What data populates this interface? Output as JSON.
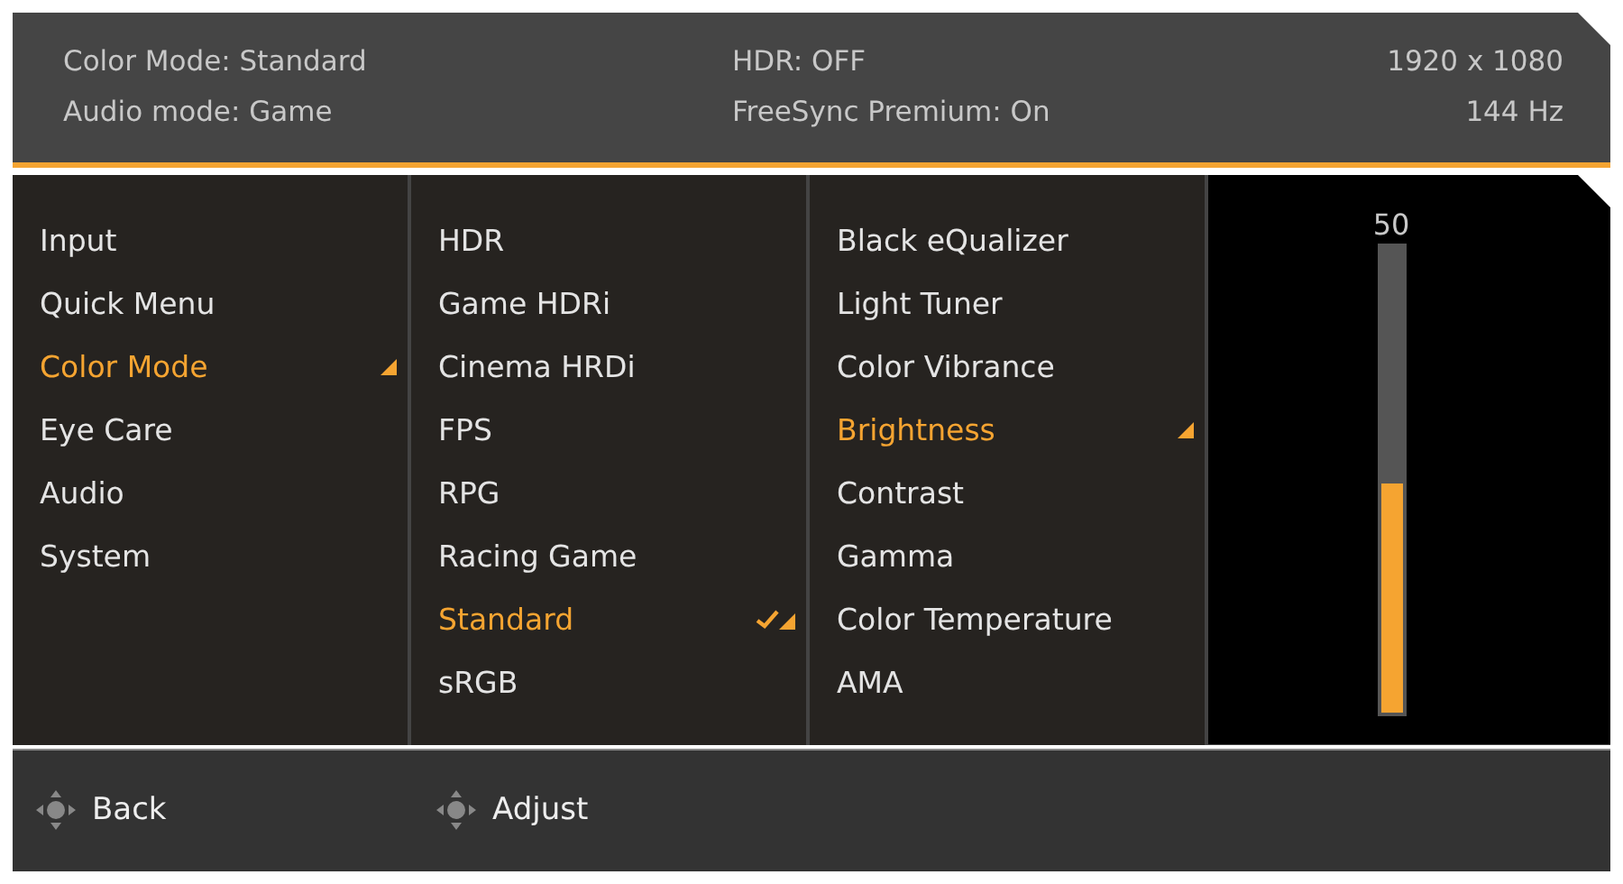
{
  "status": {
    "rows": [
      {
        "left": "Color Mode: Standard",
        "middle": "HDR: OFF",
        "right": "1920 x 1080"
      },
      {
        "left": "Audio mode: Game",
        "middle": "FreeSync Premium: On",
        "right": "144 Hz"
      }
    ]
  },
  "menus": [
    [
      {
        "label": "Input",
        "selected": false,
        "current": false
      },
      {
        "label": "Quick Menu",
        "selected": false,
        "current": false
      },
      {
        "label": "Color Mode",
        "selected": true,
        "current": false
      },
      {
        "label": "Eye Care",
        "selected": false,
        "current": false
      },
      {
        "label": "Audio",
        "selected": false,
        "current": false
      },
      {
        "label": "System",
        "selected": false,
        "current": false
      }
    ],
    [
      {
        "label": "HDR",
        "selected": false,
        "current": false
      },
      {
        "label": "Game HDRi",
        "selected": false,
        "current": false
      },
      {
        "label": "Cinema HRDi",
        "selected": false,
        "current": false
      },
      {
        "label": "FPS",
        "selected": false,
        "current": false
      },
      {
        "label": "RPG",
        "selected": false,
        "current": false
      },
      {
        "label": "Racing Game",
        "selected": false,
        "current": false
      },
      {
        "label": "Standard",
        "selected": true,
        "current": true
      },
      {
        "label": "sRGB",
        "selected": false,
        "current": false
      }
    ],
    [
      {
        "label": "Black eQualizer",
        "selected": false,
        "current": false
      },
      {
        "label": "Light Tuner",
        "selected": false,
        "current": false
      },
      {
        "label": "Color Vibrance",
        "selected": false,
        "current": false
      },
      {
        "label": "Brightness",
        "selected": true,
        "current": false
      },
      {
        "label": "Contrast",
        "selected": false,
        "current": false
      },
      {
        "label": "Gamma",
        "selected": false,
        "current": false
      },
      {
        "label": "Color Temperature",
        "selected": false,
        "current": false
      },
      {
        "label": "AMA",
        "selected": false,
        "current": false
      }
    ]
  ],
  "slider": {
    "reading": "50",
    "level": 0.5
  },
  "footer": [
    {
      "label": "Back"
    },
    {
      "label": "Adjust"
    }
  ]
}
